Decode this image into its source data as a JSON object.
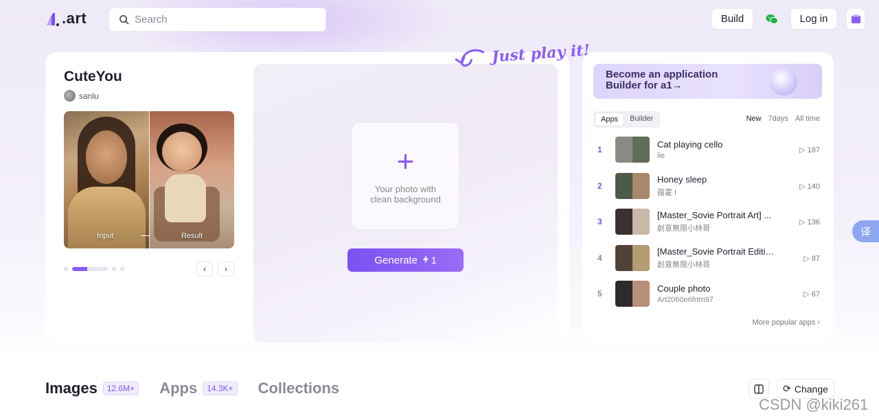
{
  "header": {
    "logo_text": ".art",
    "search_placeholder": "Search",
    "build_label": "Build",
    "login_label": "Log in"
  },
  "main": {
    "app_title": "CuteYou",
    "author": "sanlu",
    "preview_input_label": "Input",
    "preview_result_label": "Result",
    "tagline": "Just play it!",
    "upload_hint": "Your photo with clean background",
    "generate_label": "Generate",
    "generate_cost": "1",
    "carousel_prev": "‹",
    "carousel_next": "›"
  },
  "side": {
    "banner_line1": "Become an application",
    "banner_line2": "Builder for a1→",
    "tabs": [
      "Apps",
      "Builder"
    ],
    "ranges": [
      "New",
      "7days",
      "All time"
    ],
    "apps": [
      {
        "rank": "1",
        "title": "Cat playing cello",
        "user": "lie",
        "plays": "187"
      },
      {
        "rank": "2",
        "title": "Honey sleep",
        "user": "蕴霍 I",
        "plays": "140"
      },
      {
        "rank": "3",
        "title": "[Master_Sovie Portrait Art] ...",
        "user": "創意無限小林哥",
        "plays": "136"
      },
      {
        "rank": "4",
        "title": "[Master_Sovie Portrait Editio...",
        "user": "創意無限小林哥",
        "plays": "87"
      },
      {
        "rank": "5",
        "title": "Couple photo",
        "user": "Art2060e6frtm97",
        "plays": "67"
      }
    ],
    "more_label": "More popular apps"
  },
  "bottom": {
    "tabs": [
      {
        "label": "Images",
        "count": "12.6M+"
      },
      {
        "label": "Apps",
        "count": "14.3K+"
      },
      {
        "label": "Collections",
        "count": ""
      }
    ],
    "change_label": "Change"
  },
  "misc": {
    "translate_glyph": "译",
    "watermark": "CSDN @kiki261"
  },
  "colors": {
    "accent": "#8b5cf6",
    "background": "#efeaf8"
  }
}
